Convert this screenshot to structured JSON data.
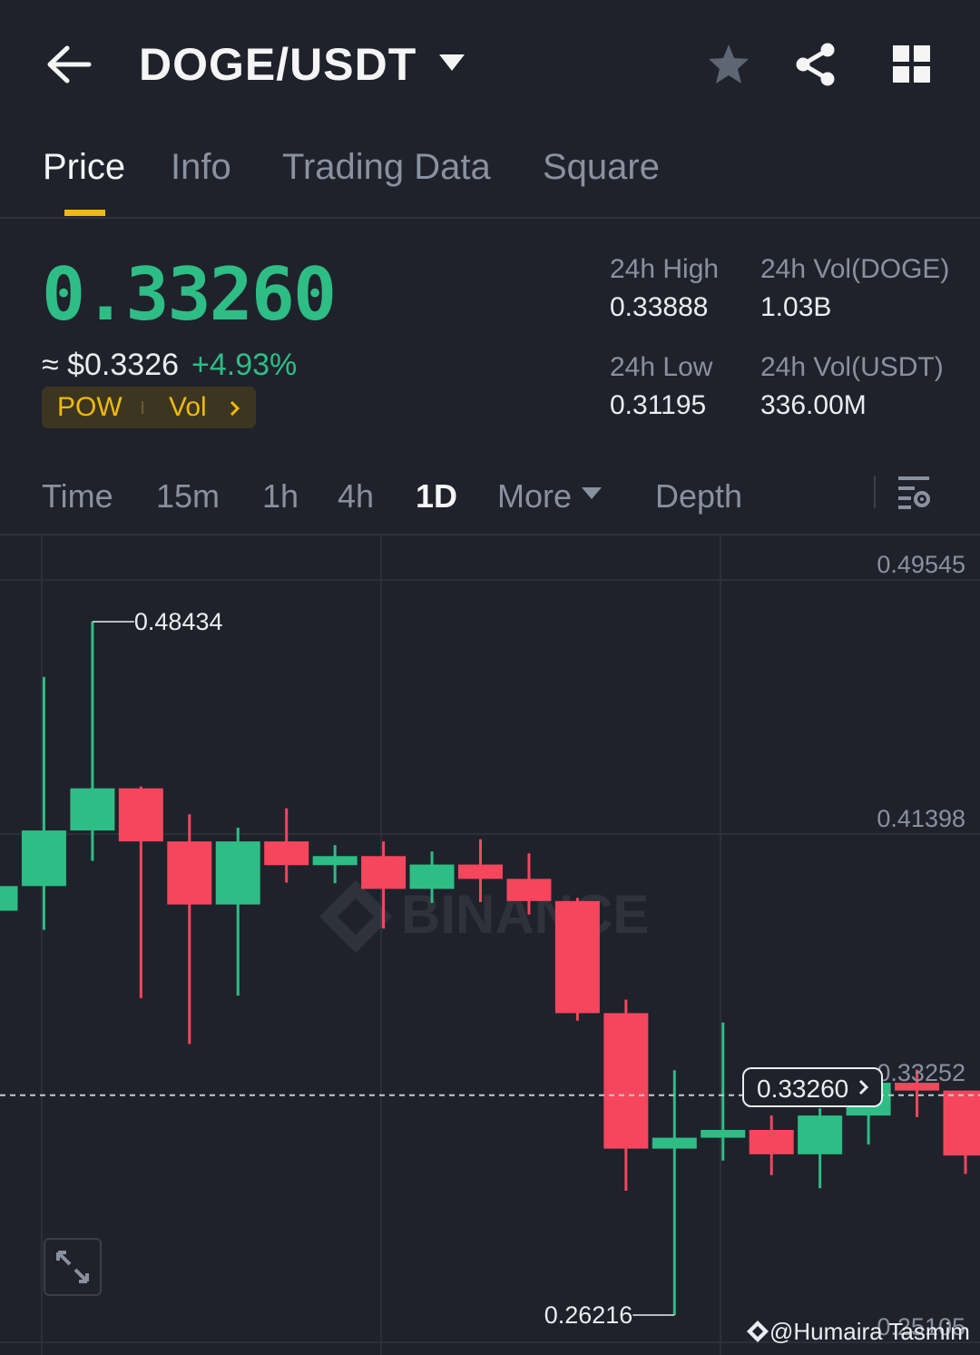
{
  "header": {
    "pair": "DOGE/USDT",
    "icons": [
      "back-arrow-icon",
      "caret-down-icon",
      "star-icon",
      "share-icon",
      "grid-icon"
    ]
  },
  "tabs": [
    {
      "label": "Price",
      "active": true
    },
    {
      "label": "Info",
      "active": false
    },
    {
      "label": "Trading Data",
      "active": false
    },
    {
      "label": "Square",
      "active": false
    }
  ],
  "ticker": {
    "last_price": "0.33260",
    "approx_usd": "≈ $0.3326",
    "change": "+4.93%",
    "tags": [
      "POW",
      "Vol"
    ],
    "stats": {
      "high_label": "24h High",
      "high_value": "0.33888",
      "low_label": "24h Low",
      "low_value": "0.31195",
      "vol_base_label": "24h Vol(DOGE)",
      "vol_base_value": "1.03B",
      "vol_quote_label": "24h Vol(USDT)",
      "vol_quote_value": "336.00M"
    }
  },
  "intervals": [
    {
      "label": "Time",
      "active": false
    },
    {
      "label": "15m",
      "active": false
    },
    {
      "label": "1h",
      "active": false
    },
    {
      "label": "4h",
      "active": false
    },
    {
      "label": "1D",
      "active": true
    },
    {
      "label": "More",
      "active": false
    },
    {
      "label": "Depth",
      "active": false
    }
  ],
  "chart_data": {
    "type": "candlestick",
    "y_axis_labels": [
      "0.49545",
      "0.41398",
      "0.33252",
      "0.25105"
    ],
    "ylim": [
      0.2494,
      0.5119
    ],
    "max_marker": "0.48434",
    "min_marker": "0.26216",
    "current_price": "0.33260",
    "watermark": "BINANCE",
    "candles": [
      {
        "o": 0.3917,
        "h": 0.4002,
        "l": 0.3864,
        "c": 0.3996
      },
      {
        "o": 0.3996,
        "h": 0.4666,
        "l": 0.3856,
        "c": 0.4174
      },
      {
        "o": 0.4174,
        "h": 0.4843,
        "l": 0.4077,
        "c": 0.4309
      },
      {
        "o": 0.4309,
        "h": 0.4315,
        "l": 0.3637,
        "c": 0.4139
      },
      {
        "o": 0.4139,
        "h": 0.4226,
        "l": 0.349,
        "c": 0.3937
      },
      {
        "o": 0.3937,
        "h": 0.4183,
        "l": 0.3645,
        "c": 0.4139
      },
      {
        "o": 0.4139,
        "h": 0.4245,
        "l": 0.4007,
        "c": 0.4063
      },
      {
        "o": 0.4063,
        "h": 0.4127,
        "l": 0.4005,
        "c": 0.4092
      },
      {
        "o": 0.4092,
        "h": 0.4139,
        "l": 0.386,
        "c": 0.3987
      },
      {
        "o": 0.3987,
        "h": 0.4107,
        "l": 0.3942,
        "c": 0.4065
      },
      {
        "o": 0.4065,
        "h": 0.4146,
        "l": 0.3945,
        "c": 0.4019
      },
      {
        "o": 0.4019,
        "h": 0.4101,
        "l": 0.3905,
        "c": 0.3948
      },
      {
        "o": 0.3948,
        "h": 0.3958,
        "l": 0.3565,
        "c": 0.3589
      },
      {
        "o": 0.3589,
        "h": 0.3632,
        "l": 0.302,
        "c": 0.3155
      },
      {
        "o": 0.3155,
        "h": 0.3406,
        "l": 0.2622,
        "c": 0.319
      },
      {
        "o": 0.319,
        "h": 0.3559,
        "l": 0.3117,
        "c": 0.3215
      },
      {
        "o": 0.3215,
        "h": 0.3261,
        "l": 0.307,
        "c": 0.3137
      },
      {
        "o": 0.3137,
        "h": 0.3284,
        "l": 0.3028,
        "c": 0.3261
      },
      {
        "o": 0.3261,
        "h": 0.339,
        "l": 0.3168,
        "c": 0.3366
      },
      {
        "o": 0.3366,
        "h": 0.3408,
        "l": 0.3256,
        "c": 0.3341
      },
      {
        "o": 0.3341,
        "h": 0.3341,
        "l": 0.3074,
        "c": 0.3133
      }
    ]
  },
  "price_tag": "0.33260",
  "credit": "@Humaira Tasmim",
  "colors": {
    "up": "#2ebd85",
    "down": "#f6465d",
    "accent": "#f0b90b",
    "bg": "#1f222b"
  }
}
